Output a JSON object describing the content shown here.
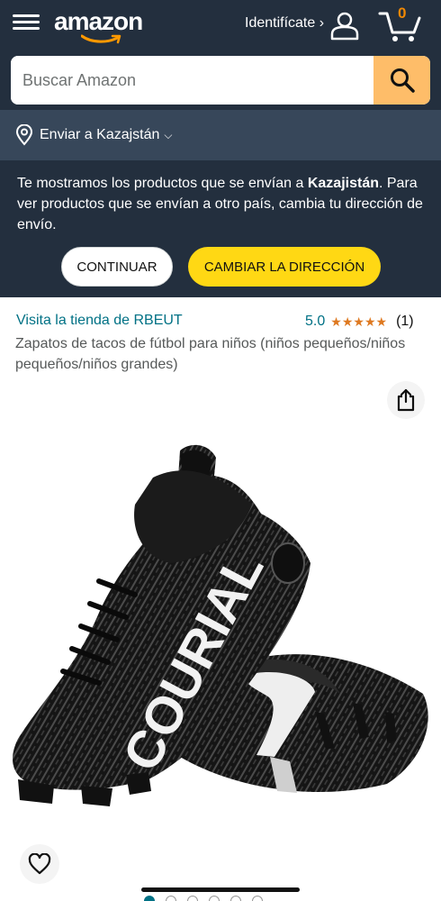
{
  "header": {
    "logo_text": "amazon",
    "signin_label": "Identifícate ›",
    "cart_count": "0"
  },
  "search": {
    "placeholder": "Buscar Amazon"
  },
  "delivery": {
    "label": "Enviar a Kazajstán",
    "chevron": "⌵"
  },
  "notice": {
    "text_before": "Te mostramos los productos que se envían a ",
    "country": "Kazajistán",
    "text_after": ". Para ver productos que se envían a otro país, cambia tu dirección de envío.",
    "continue_label": "CONTINUAR",
    "change_label": "CAMBIAR LA DIRECCIÓN"
  },
  "product": {
    "store_link": "Visita la tienda de RBEUT",
    "rating_value": "5.0",
    "stars": 5,
    "rating_count": "(1)",
    "title": "Zapatos de tacos de fútbol para niños (niños pequeños/niños pequeños/niños grandes)",
    "shoe_text": "COURIAL"
  },
  "carousel": {
    "active_index": 0
  },
  "colors": {
    "header_bg": "#232f3e",
    "delivery_bg": "#37475a",
    "search_button": "#febd69",
    "primary_button": "#ffd814",
    "link": "#007185",
    "star": "#de7921"
  }
}
